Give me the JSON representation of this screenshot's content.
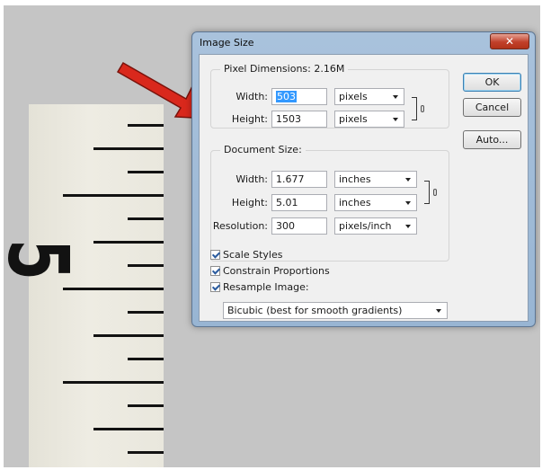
{
  "dialog": {
    "title": "Image Size",
    "close_glyph": "✕"
  },
  "pixel_dimensions": {
    "legend": "Pixel Dimensions:  2.16M",
    "width_label": "Width:",
    "width_value": "503",
    "width_unit": "pixels",
    "height_label": "Height:",
    "height_value": "1503",
    "height_unit": "pixels"
  },
  "document_size": {
    "legend": "Document Size:",
    "width_label": "Width:",
    "width_value": "1.677",
    "width_unit": "inches",
    "height_label": "Height:",
    "height_value": "5.01",
    "height_unit": "inches",
    "resolution_label": "Resolution:",
    "resolution_value": "300",
    "resolution_unit": "pixels/inch"
  },
  "buttons": {
    "ok": "OK",
    "cancel": "Cancel",
    "auto": "Auto..."
  },
  "options": {
    "scale_styles": "Scale Styles",
    "constrain_proportions": "Constrain Proportions",
    "resample_image": "Resample Image:",
    "resample_method": "Bicubic (best for smooth gradients)"
  },
  "ruler": {
    "numeral": "5"
  },
  "colors": {
    "arrow": "#d9281c",
    "title_bar": "#a9c2dc",
    "dialog_face": "#f0f0f0",
    "close_button": "#c1402a",
    "selection": "#3399ff"
  }
}
